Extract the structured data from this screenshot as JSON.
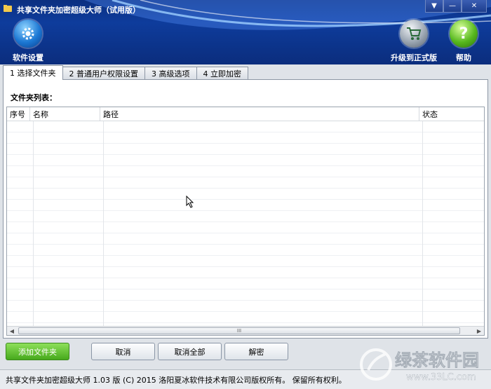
{
  "window": {
    "title": "共享文件夹加密超级大师（试用版）",
    "controls": [
      "▼",
      "—",
      "✕"
    ]
  },
  "toolbar": {
    "settings_label": "软件设置",
    "upgrade_label": "升级到正式版",
    "help_label": "帮助",
    "help_icon_glyph": "?"
  },
  "tabs": [
    {
      "label": "1 选择文件夹",
      "active": true
    },
    {
      "label": "2 普通用户权限设置",
      "active": false
    },
    {
      "label": "3 高级选项",
      "active": false
    },
    {
      "label": "4 立即加密",
      "active": false
    }
  ],
  "folder_list": {
    "label": "文件夹列表：",
    "columns": [
      "序号",
      "名称",
      "路径",
      "状态"
    ],
    "rows": [],
    "scroll_grip": "III"
  },
  "buttons": {
    "add_folder": "添加文件夹",
    "cancel": "取消",
    "cancel_all": "取消全部",
    "decrypt": "解密"
  },
  "status_bar": {
    "text": "共享文件夹加密超级大师 1.03 版  (C)  2015 洛阳夏冰软件技术有限公司版权所有。 保留所有权利。"
  },
  "watermark": {
    "name": "绿茶软件园",
    "url": "www.33LC.com"
  },
  "colors": {
    "header_bg": "#0e3c9c",
    "add_button": "#46a91c"
  }
}
